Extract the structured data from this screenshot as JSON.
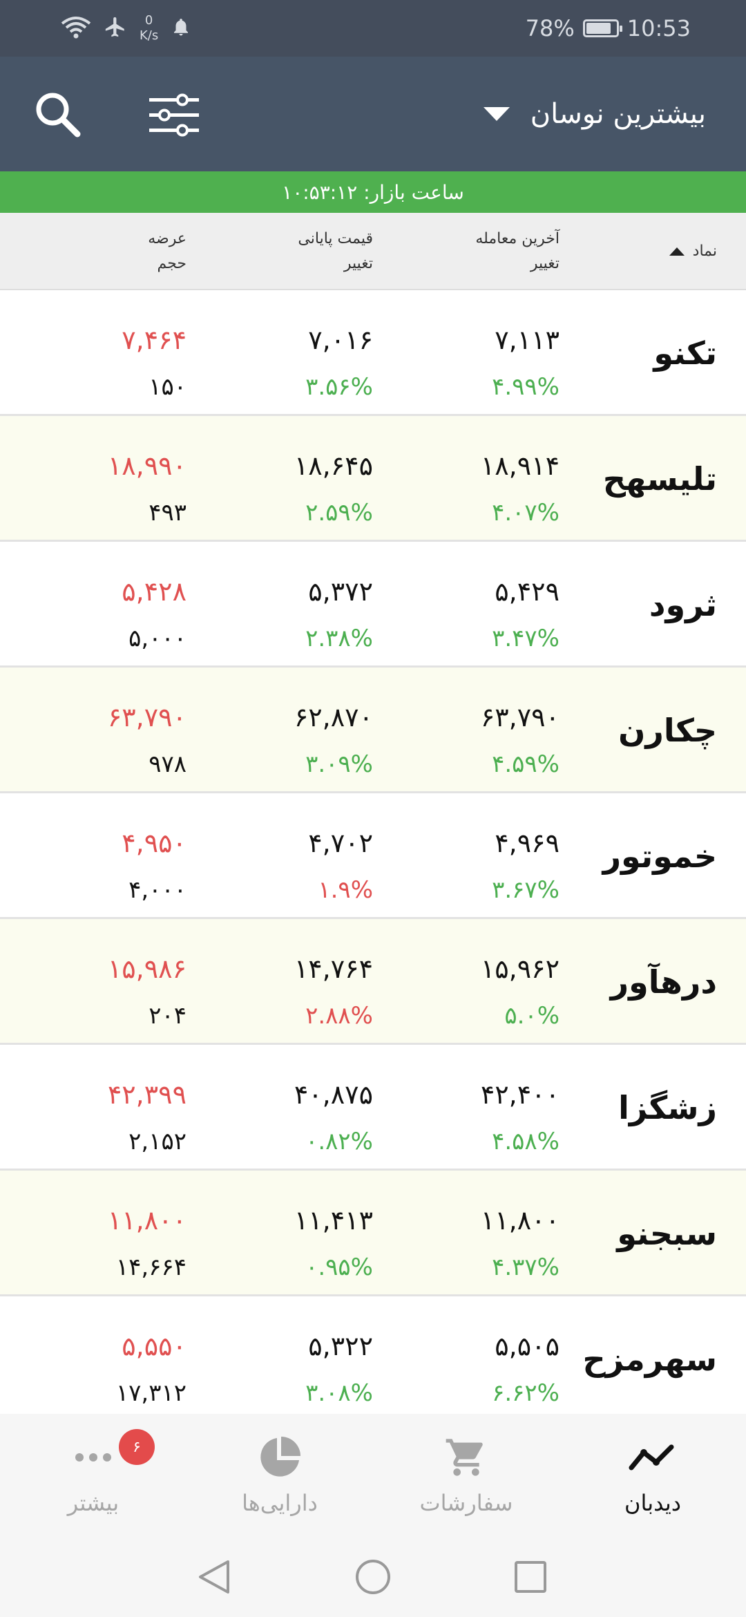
{
  "status_bar": {
    "net_speed_value": "0",
    "net_speed_unit": "K/s",
    "battery": "78%",
    "time": "10:53",
    "icons": [
      "wifi-icon",
      "airplane-icon",
      "bell-icon",
      "battery-icon"
    ]
  },
  "header": {
    "title": "بیشترین نوسان",
    "icons": [
      "search-icon",
      "filter-icon",
      "dropdown-caret-icon"
    ]
  },
  "market": {
    "label": "ساعت بازار: ۱۰:۵۳:۱۲"
  },
  "table": {
    "headers": {
      "symbol": "نماد",
      "last_trade": "آخرین معامله",
      "last_change": "تغییر",
      "final_price": "قیمت پایانی",
      "final_change": "تغییر",
      "supply": "عرضه",
      "volume": "حجم"
    },
    "rows": [
      {
        "symbol": "تکنو",
        "last": "۷,۱۱۳",
        "last_change": "۴.۹۹%",
        "final": "۷,۰۱۶",
        "final_change": "۳.۵۶%",
        "supply": "۷,۴۶۴",
        "volume": "۱۵۰",
        "final_change_dir": "up"
      },
      {
        "symbol": "تلیسهح",
        "last": "۱۸,۹۱۴",
        "last_change": "۴.۰۷%",
        "final": "۱۸,۶۴۵",
        "final_change": "۲.۵۹%",
        "supply": "۱۸,۹۹۰",
        "volume": "۴۹۳",
        "final_change_dir": "up"
      },
      {
        "symbol": "ثرود",
        "last": "۵,۴۲۹",
        "last_change": "۳.۴۷%",
        "final": "۵,۳۷۲",
        "final_change": "۲.۳۸%",
        "supply": "۵,۴۲۸",
        "volume": "۵,۰۰۰",
        "final_change_dir": "up"
      },
      {
        "symbol": "چکارن",
        "last": "۶۳,۷۹۰",
        "last_change": "۴.۵۹%",
        "final": "۶۲,۸۷۰",
        "final_change": "۳.۰۹%",
        "supply": "۶۳,۷۹۰",
        "volume": "۹۷۸",
        "final_change_dir": "up"
      },
      {
        "symbol": "خموتور",
        "last": "۴,۹۶۹",
        "last_change": "۳.۶۷%",
        "final": "۴,۷۰۲",
        "final_change": "۱.۹%",
        "supply": "۴,۹۵۰",
        "volume": "۴,۰۰۰",
        "final_change_dir": "down"
      },
      {
        "symbol": "درهآور",
        "last": "۱۵,۹۶۲",
        "last_change": "۵.۰%",
        "final": "۱۴,۷۶۴",
        "final_change": "۲.۸۸%",
        "supply": "۱۵,۹۸۶",
        "volume": "۲۰۴",
        "final_change_dir": "down"
      },
      {
        "symbol": "زشگزا",
        "last": "۴۲,۴۰۰",
        "last_change": "۴.۵۸%",
        "final": "۴۰,۸۷۵",
        "final_change": "۰.۸۲%",
        "supply": "۴۲,۳۹۹",
        "volume": "۲,۱۵۲",
        "final_change_dir": "up"
      },
      {
        "symbol": "سبجنو",
        "last": "۱۱,۸۰۰",
        "last_change": "۴.۳۷%",
        "final": "۱۱,۴۱۳",
        "final_change": "۰.۹۵%",
        "supply": "۱۱,۸۰۰",
        "volume": "۱۴,۶۶۴",
        "final_change_dir": "up"
      },
      {
        "symbol": "سهرمزح",
        "last": "۵,۵۰۵",
        "last_change": "۶.۶۲%",
        "final": "۵,۳۲۲",
        "final_change": "۳.۰۸%",
        "supply": "۵,۵۵۰",
        "volume": "۱۷,۳۱۲",
        "final_change_dir": "up"
      }
    ]
  },
  "bottom_nav": {
    "items": [
      {
        "label": "دیدبان",
        "icon": "watchlist-chart-icon",
        "active": true
      },
      {
        "label": "سفارشات",
        "icon": "cart-icon",
        "active": false
      },
      {
        "label": "دارایی‌ها",
        "icon": "pie-chart-icon",
        "active": false
      },
      {
        "label": "بیشتر",
        "icon": "more-dots-icon",
        "active": false,
        "badge": "۶"
      }
    ]
  },
  "colors": {
    "header_bg": "#475567",
    "market_bar": "#4fb04f",
    "green": "#4caf50",
    "red": "#e05050"
  }
}
